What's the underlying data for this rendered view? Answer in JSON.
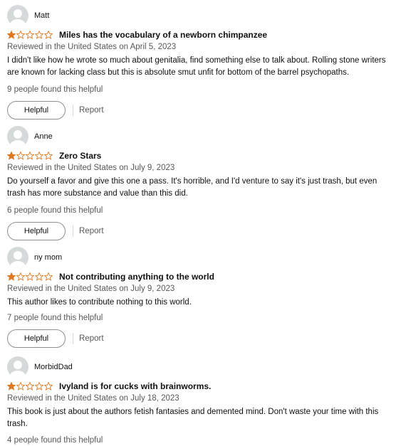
{
  "colors": {
    "star": "#de7921",
    "star_empty": "#de7921",
    "avatar": "#d5d9d9",
    "muted": "#565959"
  },
  "reviews": [
    {
      "author": "Matt",
      "rating": 1,
      "title": "Miles has the vocabulary of a newborn chimpanzee",
      "meta": "Reviewed in the United States on April 5, 2023",
      "body": "I didn't like how he wrote so much about genitalia, find something else to talk about. Rolling stone writers are known for lacking class but this is absolute smut unfit for bottom of the barrel psychopaths.",
      "helpful_count": "9 people found this helpful",
      "helpful_label": "Helpful",
      "report_label": "Report"
    },
    {
      "author": "Anne",
      "rating": 1,
      "title": "Zero Stars",
      "meta": "Reviewed in the United States on July 9, 2023",
      "body": "Do yourself a favor and give this one a pass. It's horrible, and I'd venture to say it's just trash, but even trash has more substance and value than this did.",
      "helpful_count": "6 people found this helpful",
      "helpful_label": "Helpful",
      "report_label": "Report"
    },
    {
      "author": "ny mom",
      "rating": 1,
      "title": "Not contributing anything to the world",
      "meta": "Reviewed in the United States on July 9, 2023",
      "body": "This author likes to contribute nothing to this world.",
      "helpful_count": "7 people found this helpful",
      "helpful_label": "Helpful",
      "report_label": "Report"
    },
    {
      "author": "MorbidDad",
      "rating": 1,
      "title": "Ivyland is for cucks with brainworms.",
      "meta": "Reviewed in the United States on July 18, 2023",
      "body": "This book is just about the authors fetish fantasies and demented mind. Don't waste your time with this trash.",
      "helpful_count": "4 people found this helpful"
    }
  ]
}
